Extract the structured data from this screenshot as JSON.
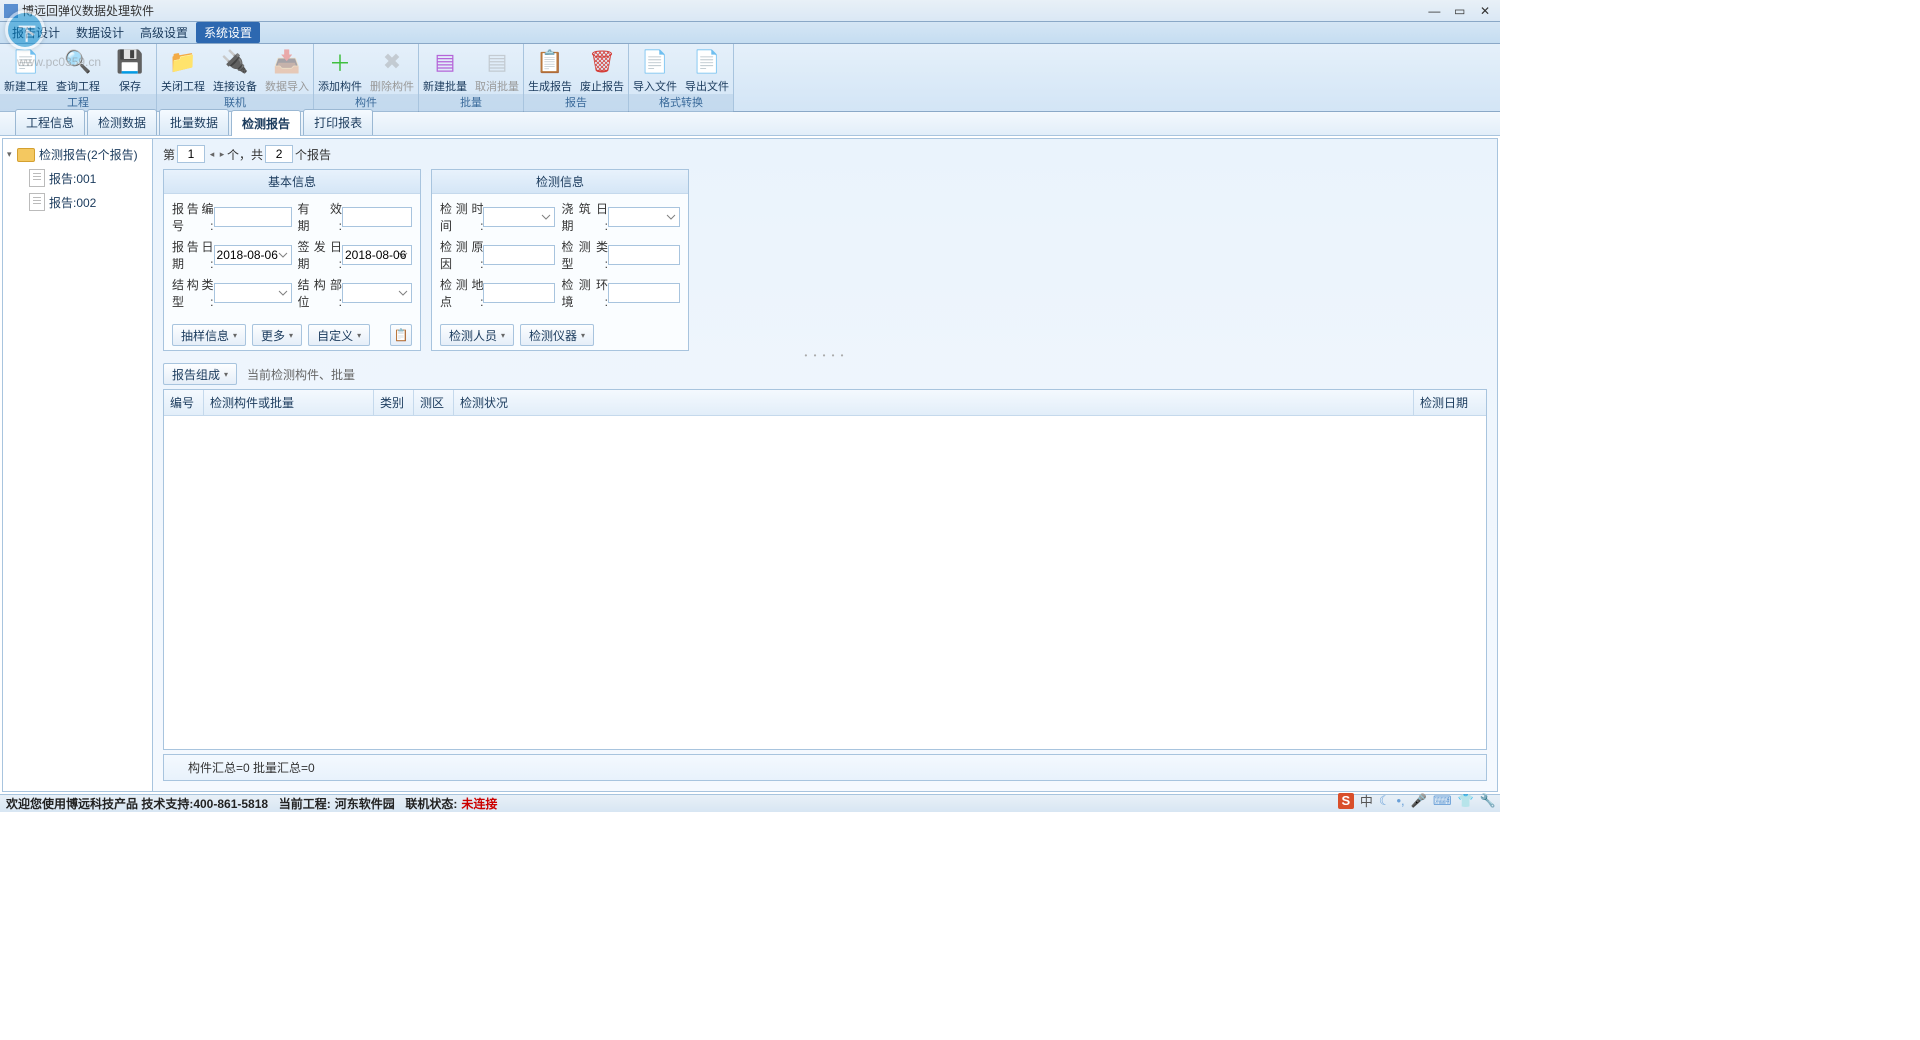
{
  "app": {
    "title": "博远回弹仪数据处理软件"
  },
  "watermark": {
    "url": "www.pc0359.cn"
  },
  "menu": {
    "items": [
      "报告设计",
      "数据设计",
      "高级设置"
    ],
    "active": "系统设置"
  },
  "ribbon": {
    "groups": [
      {
        "label": "工程",
        "buttons": [
          {
            "name": "新建工程",
            "color": "#2a7de1",
            "glyph": "📄"
          },
          {
            "name": "查询工程",
            "color": "#2a7de1",
            "glyph": "🔍"
          },
          {
            "name": "保存",
            "color": "#2a7de1",
            "glyph": "💾"
          }
        ]
      },
      {
        "label": "联机",
        "buttons": [
          {
            "name": "关闭工程",
            "color": "#5aa0e8",
            "glyph": "📁"
          },
          {
            "name": "连接设备",
            "color": "#5aa0e8",
            "glyph": "🔌"
          },
          {
            "name": "数据导入",
            "disabled": true,
            "glyph": "📥"
          }
        ]
      },
      {
        "label": "构件",
        "buttons": [
          {
            "name": "添加构件",
            "color": "#3fbf3f",
            "glyph": "＋"
          },
          {
            "name": "删除构件",
            "disabled": true,
            "glyph": "✖"
          }
        ]
      },
      {
        "label": "批量",
        "buttons": [
          {
            "name": "新建批量",
            "color": "#b565d8",
            "glyph": "▤"
          },
          {
            "name": "取消批量",
            "disabled": true,
            "glyph": "▤"
          }
        ]
      },
      {
        "label": "报告",
        "buttons": [
          {
            "name": "生成报告",
            "color": "#2a7de1",
            "glyph": "📋"
          },
          {
            "name": "废止报告",
            "color": "#d43f3a",
            "glyph": "🗑"
          }
        ]
      },
      {
        "label": "格式转换",
        "buttons": [
          {
            "name": "导入文件",
            "color": "#2a7de1",
            "glyph": "📄"
          },
          {
            "name": "导出文件",
            "color": "#2a7de1",
            "glyph": "📄"
          }
        ]
      }
    ]
  },
  "tabs": {
    "items": [
      "工程信息",
      "检测数据",
      "批量数据",
      "检测报告",
      "打印报表"
    ],
    "active": "检测报告"
  },
  "tree": {
    "root": "检测报告(2个报告)",
    "children": [
      "报告:001",
      "报告:002"
    ]
  },
  "pager": {
    "label_pre": "第",
    "current": "1",
    "label_mid": "个，共",
    "total": "2",
    "label_post": "个报告"
  },
  "basic_info": {
    "title": "基本信息",
    "report_no_label": "报告编号:",
    "report_no": "",
    "valid_label": "有 效 期:",
    "valid": "",
    "report_date_label": "报告日期:",
    "report_date": "2018-08-06",
    "sign_date_label": "签发日期:",
    "sign_date": "2018-08-06",
    "struct_type_label": "结构类型:",
    "struct_type": "",
    "struct_part_label": "结构部位:",
    "struct_part": "",
    "btn_sample": "抽样信息",
    "btn_more": "更多",
    "btn_custom": "自定义"
  },
  "detect_info": {
    "title": "检测信息",
    "time_label": "检测时间:",
    "time": "",
    "pour_label": "浇筑日期:",
    "pour": "",
    "reason_label": "检测原因:",
    "reason": "",
    "type_label": "检测类型:",
    "type": "",
    "place_label": "检测地点:",
    "place": "",
    "env_label": "检测环境:",
    "env": "",
    "btn_person": "检测人员",
    "btn_device": "检测仪器"
  },
  "composition": {
    "btn": "报告组成",
    "text": "当前检测构件、批量"
  },
  "table": {
    "headers": [
      "编号",
      "检测构件或批量",
      "类别",
      "测区",
      "检测状况",
      "检测日期"
    ]
  },
  "footer": {
    "summary": "构件汇总=0 批量汇总=0"
  },
  "status": {
    "welcome": "欢迎您使用博远科技产品 技术支持:400-861-5818",
    "project_label": "当前工程:",
    "project": "河东软件园",
    "conn_label": "联机状态:",
    "conn": "未连接"
  },
  "ime": {
    "lang": "中"
  }
}
